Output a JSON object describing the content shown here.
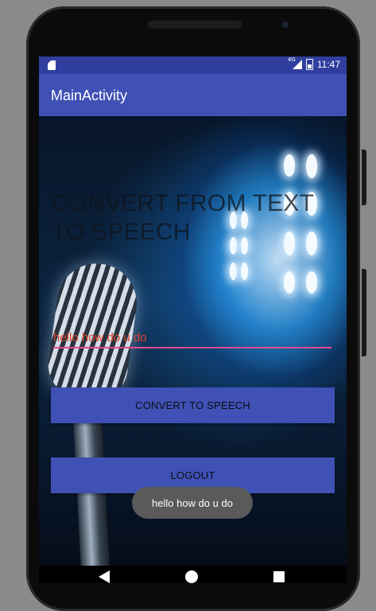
{
  "status_bar": {
    "network": "4G",
    "time": "11:47"
  },
  "app_bar": {
    "title": "MainActivity"
  },
  "main": {
    "heading": "CONVERT FROM TEXT TO SPEECH",
    "text_input": {
      "value": "hello how do u do"
    },
    "convert_button": "CONVERT TO SPEECH",
    "logout_button": "LOGOUT"
  },
  "toast": {
    "message": "hello how do u do"
  },
  "colors": {
    "primary": "#3f51b5",
    "primary_dark": "#303f9f",
    "accent": "#e04b8e"
  },
  "icons": {
    "status_left": "sd-card-icon",
    "status_signal": "signal-icon",
    "status_battery": "battery-icon",
    "nav_back": "back-icon",
    "nav_home": "home-icon",
    "nav_recent": "recents-icon"
  }
}
